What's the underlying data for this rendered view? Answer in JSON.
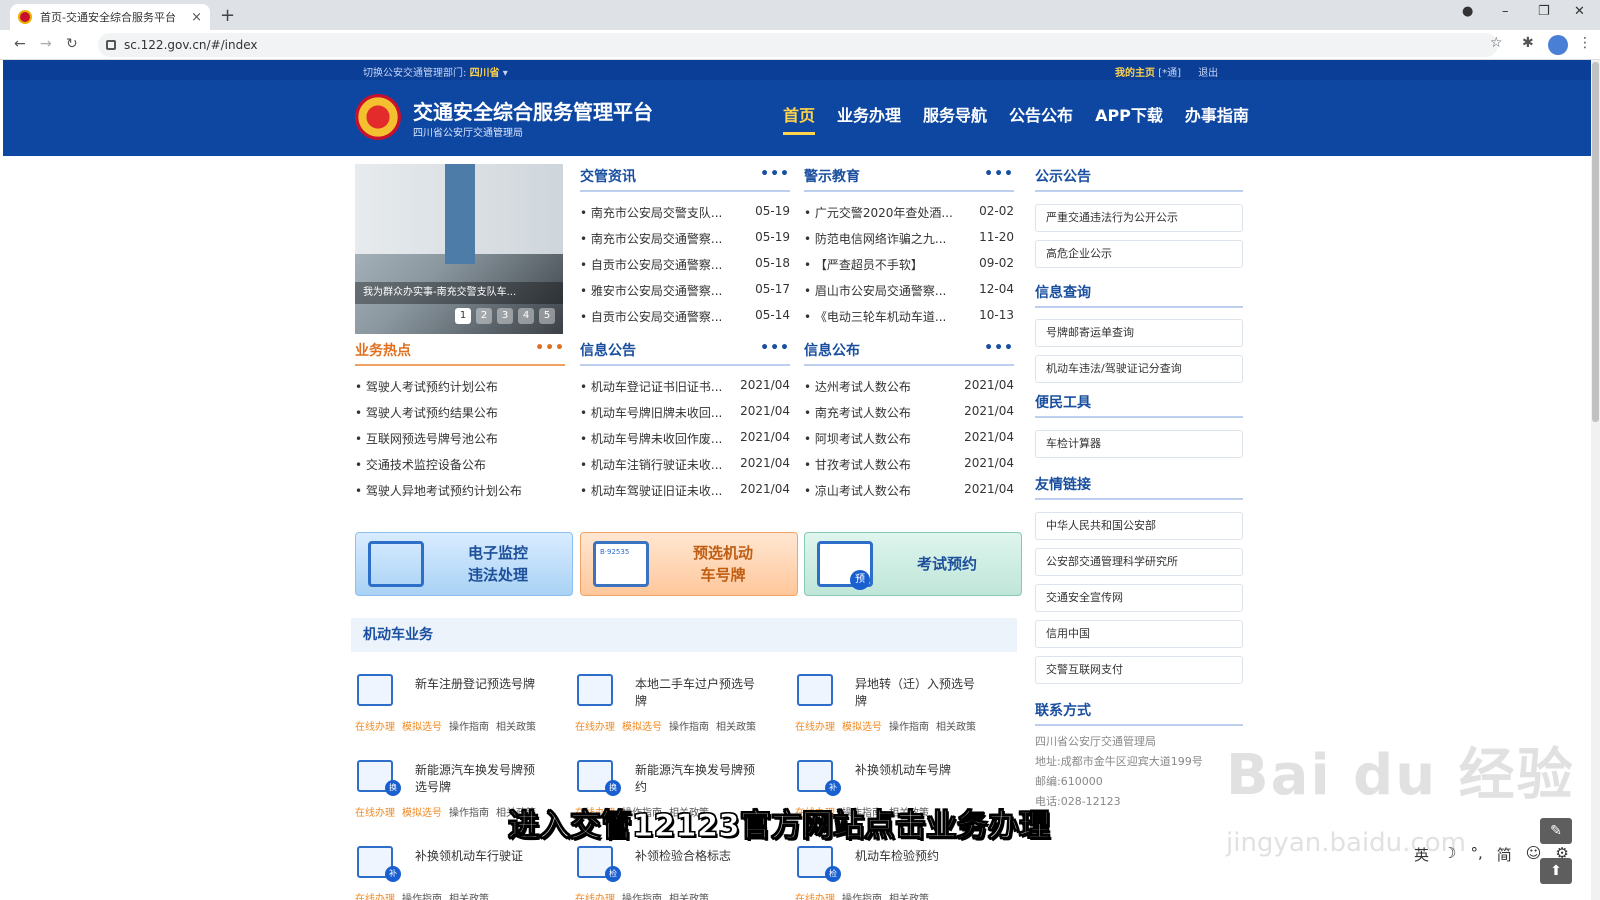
{
  "browser": {
    "tab_title": "首页-交通安全综合服务平台",
    "tab_close": "×",
    "new_tab": "+",
    "url": "sc.122.gov.cn/#/index",
    "win_min": "–",
    "win_max": "❐",
    "win_close": "✕"
  },
  "topbar": {
    "switch_label": "切换公安交通管理部门:",
    "province": "四川省",
    "my_home": "我的主页",
    "my_home_suffix": "[*通]",
    "logout": "退出"
  },
  "header": {
    "title": "交通安全综合服务管理平台",
    "subtitle": "四川省公安厅交通管理局",
    "nav": [
      "首页",
      "业务办理",
      "服务导航",
      "公告公布",
      "APP下载",
      "办事指南"
    ]
  },
  "banner": {
    "caption": "我为群众办实事-南充交警支队车...",
    "dots": [
      "1",
      "2",
      "3",
      "4",
      "5"
    ]
  },
  "sections": {
    "jgzx": {
      "title": "交管资讯",
      "more": "•••",
      "items": [
        {
          "t": "南充市公安局交警支队...",
          "d": "05-19"
        },
        {
          "t": "南充市公安局交通警察...",
          "d": "05-19"
        },
        {
          "t": "自贡市公安局交通警察...",
          "d": "05-18"
        },
        {
          "t": "雅安市公安局交通警察...",
          "d": "05-17"
        },
        {
          "t": "自贡市公安局交通警察...",
          "d": "05-14"
        }
      ]
    },
    "jsjy": {
      "title": "警示教育",
      "more": "•••",
      "items": [
        {
          "t": "广元交警2020年查处酒...",
          "d": "02-02"
        },
        {
          "t": "防范电信网络诈骗之九...",
          "d": "11-20"
        },
        {
          "t": "【严查超员不手软】",
          "d": "09-02"
        },
        {
          "t": "眉山市公安局交通警察...",
          "d": "12-04"
        },
        {
          "t": "《电动三轮车机动车道...",
          "d": "10-13"
        }
      ]
    },
    "ywrd": {
      "title": "业务热点",
      "more": "•••",
      "items": [
        {
          "t": "驾驶人考试预约计划公布"
        },
        {
          "t": "驾驶人考试预约结果公布"
        },
        {
          "t": "互联网预选号牌号池公布"
        },
        {
          "t": "交通技术监控设备公布"
        },
        {
          "t": "驾驶人异地考试预约计划公布"
        }
      ]
    },
    "xxgg": {
      "title": "信息公告",
      "more": "•••",
      "items": [
        {
          "t": "机动车登记证书旧证书...",
          "d": "2021/04"
        },
        {
          "t": "机动车号牌旧牌未收回...",
          "d": "2021/04"
        },
        {
          "t": "机动车号牌未收回作废...",
          "d": "2021/04"
        },
        {
          "t": "机动车注销行驶证未收...",
          "d": "2021/04"
        },
        {
          "t": "机动车驾驶证旧证未收...",
          "d": "2021/04"
        }
      ]
    },
    "xxgb": {
      "title": "信息公布",
      "more": "•••",
      "items": [
        {
          "t": "达州考试人数公布",
          "d": "2021/04"
        },
        {
          "t": "南充考试人数公布",
          "d": "2021/04"
        },
        {
          "t": "阿坝考试人数公布",
          "d": "2021/04"
        },
        {
          "t": "甘孜考试人数公布",
          "d": "2021/04"
        },
        {
          "t": "凉山考试人数公布",
          "d": "2021/04"
        }
      ]
    }
  },
  "sidebar": {
    "gsgg": {
      "title": "公示公告",
      "items": [
        "严重交通违法行为公开公示",
        "高危企业公示"
      ]
    },
    "xxcx": {
      "title": "信息查询",
      "items": [
        "号牌邮寄运单查询",
        "机动车违法/驾驶证记分查询"
      ]
    },
    "bmgj": {
      "title": "便民工具",
      "items": [
        "车检计算器"
      ]
    },
    "yqlj": {
      "title": "友情链接",
      "items": [
        "中华人民共和国公安部",
        "公安部交通管理科学研究所",
        "交通安全宣传网",
        "信用中国",
        "交警互联网支付"
      ]
    },
    "lxfs": {
      "title": "联系方式",
      "lines": [
        "四川省公安厅交通管理局",
        "地址:成都市金牛区迎宾大道199号",
        "邮编:610000",
        "电话:028-12123"
      ]
    }
  },
  "quick": [
    {
      "l1": "电子监控",
      "l2": "违法处理"
    },
    {
      "l1": "预选机动",
      "l2": "车号牌"
    },
    {
      "l1": "考试预约",
      "l2": ""
    }
  ],
  "quick_badge": "预",
  "plate_text": "B·92535",
  "mv": {
    "title": "机动车业务",
    "items": [
      {
        "name": "新车注册登记预选号牌",
        "links": [
          "在线办理",
          "模拟选号",
          "操作指南",
          "相关政策"
        ]
      },
      {
        "name": "本地二手车过户预选号牌",
        "links": [
          "在线办理",
          "模拟选号",
          "操作指南",
          "相关政策"
        ]
      },
      {
        "name": "异地转（迁）入预选号牌",
        "links": [
          "在线办理",
          "模拟选号",
          "操作指南",
          "相关政策"
        ]
      },
      {
        "name": "新能源汽车换发号牌预选号牌",
        "links": [
          "在线办理",
          "模拟选号",
          "操作指南",
          "相关政策"
        ]
      },
      {
        "name": "新能源汽车换发号牌预约",
        "links": [
          "在线办理",
          "操作指南",
          "相关政策"
        ]
      },
      {
        "name": "补换领机动车号牌",
        "links": [
          "在线办理",
          "操作指南",
          "相关政策"
        ]
      },
      {
        "name": "补换领机动车行驶证",
        "links": [
          "在线办理",
          "操作指南",
          "相关政策"
        ]
      },
      {
        "name": "补领检验合格标志",
        "links": [
          "在线办理",
          "操作指南",
          "相关政策"
        ]
      },
      {
        "name": "机动车检验预约",
        "links": [
          "在线办理",
          "操作指南",
          "相关政策"
        ]
      }
    ],
    "badges": [
      "",
      "",
      "",
      "换",
      "换",
      "补",
      "补",
      "检",
      "检"
    ]
  },
  "overlay": {
    "subtitle": "进入交管12123官方网站点击业务办理",
    "watermark": "Bai du 经验",
    "watermark2": "jingyan.baidu.com",
    "ime": [
      "英",
      "☽",
      "°,",
      "简",
      "☺",
      "⚙"
    ],
    "edit_icon": "✎",
    "top_icon": "⬆"
  }
}
